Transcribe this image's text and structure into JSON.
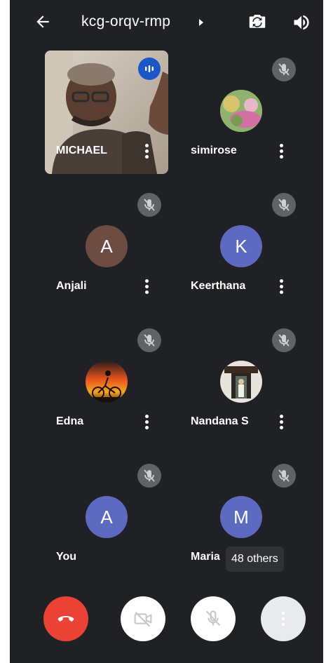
{
  "header": {
    "meeting_code": "kcg-orqv-rmp"
  },
  "participants": [
    {
      "name": "MICHAEL",
      "avatar": "video"
    },
    {
      "name": "simirose",
      "avatar": "photo-flowers"
    },
    {
      "name": "Anjali",
      "initial": "A",
      "color": "#6d4c41"
    },
    {
      "name": "Keerthana",
      "initial": "K",
      "color": "#5c6bc0"
    },
    {
      "name": "Edna",
      "avatar": "photo-sunset-bicycle"
    },
    {
      "name": "Nandana S",
      "avatar": "photo-doorway"
    },
    {
      "name": "You",
      "initial": "A",
      "color": "#5c6bc0"
    },
    {
      "name": "Maria",
      "initial": "M",
      "color": "#5c6bc0"
    }
  ],
  "others_chip": "48 others",
  "controls": {
    "end_call": "phone-hangup-icon",
    "camera": "camera-off-icon",
    "mic": "mic-off-icon",
    "more": "more-options-icon"
  },
  "colors": {
    "background": "#202124",
    "end_call": "#ea4335",
    "mute_badge": "#5f6368",
    "speaking": "#1a56c8"
  }
}
